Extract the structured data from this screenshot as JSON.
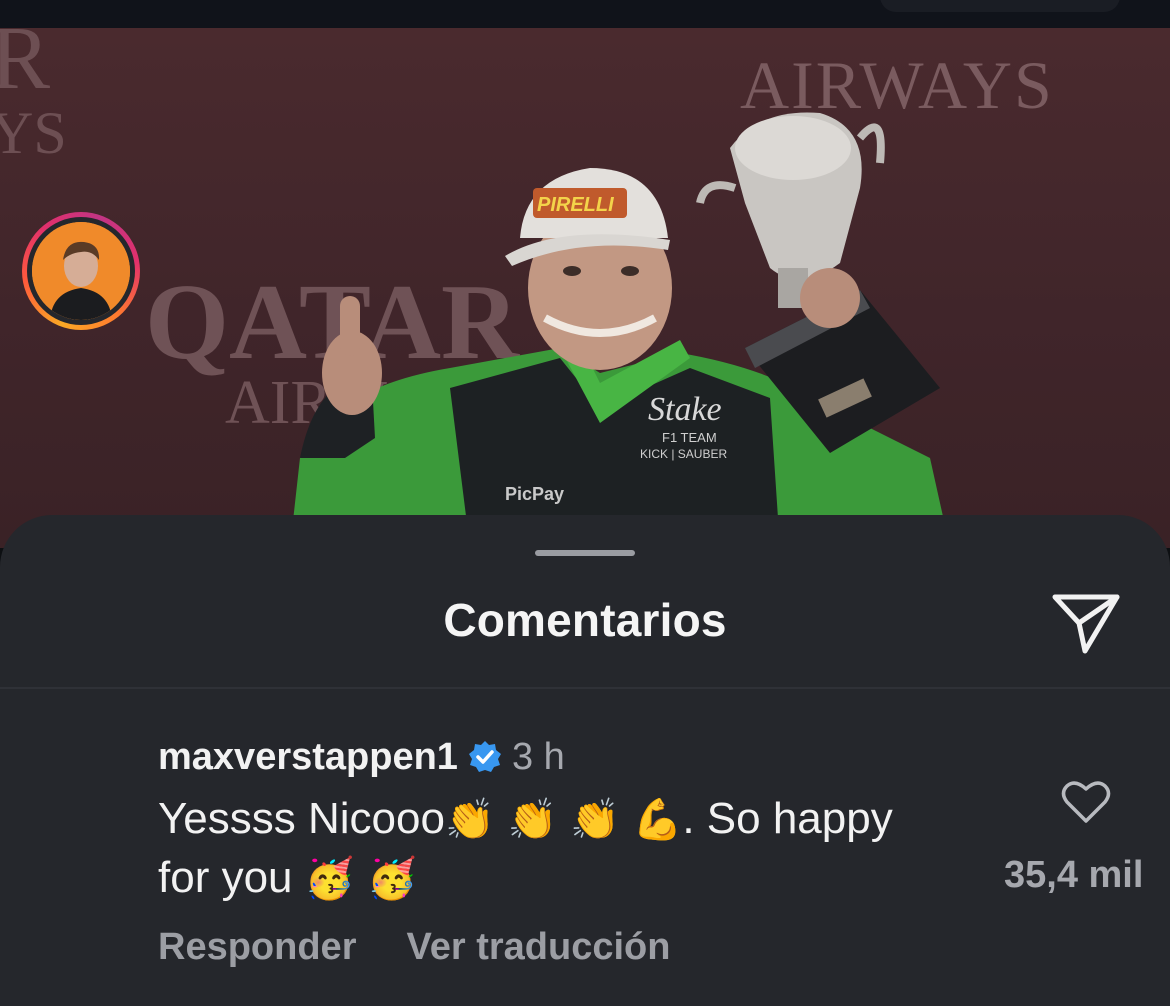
{
  "photo": {
    "banner_top": "AIRWAYS",
    "banner_left_brand": "QATAR",
    "banner_left_sub": "AIRWAYS",
    "cap_brand": "PIRELLI",
    "suit_brand": "Stake",
    "suit_team": "F1 TEAM",
    "suit_sub": "KICK | SAUBER",
    "suit_sponsor": "PicPay"
  },
  "sheet": {
    "title": "Comentarios",
    "share_icon": "paper-plane-icon"
  },
  "comment": {
    "username": "maxverstappen1",
    "verified_icon": "verified-badge-icon",
    "time": "3 h",
    "text_line1": "Yessss Nicooo",
    "emoji_line1": "👏 👏 👏 💪",
    "text_line1_end": ". So happy",
    "text_line2": "for you",
    "emoji_line2": "🥳 🥳",
    "reply_label": "Responder",
    "translate_label": "Ver traducción",
    "like_icon": "heart-outline-icon",
    "like_count": "35,4 mil"
  },
  "colors": {
    "sheet_bg": "#25272c",
    "text_primary": "#f2f2f2",
    "text_secondary": "#a6a8ae",
    "verified_blue": "#3897f0",
    "suit_green": "#3fa83a"
  }
}
